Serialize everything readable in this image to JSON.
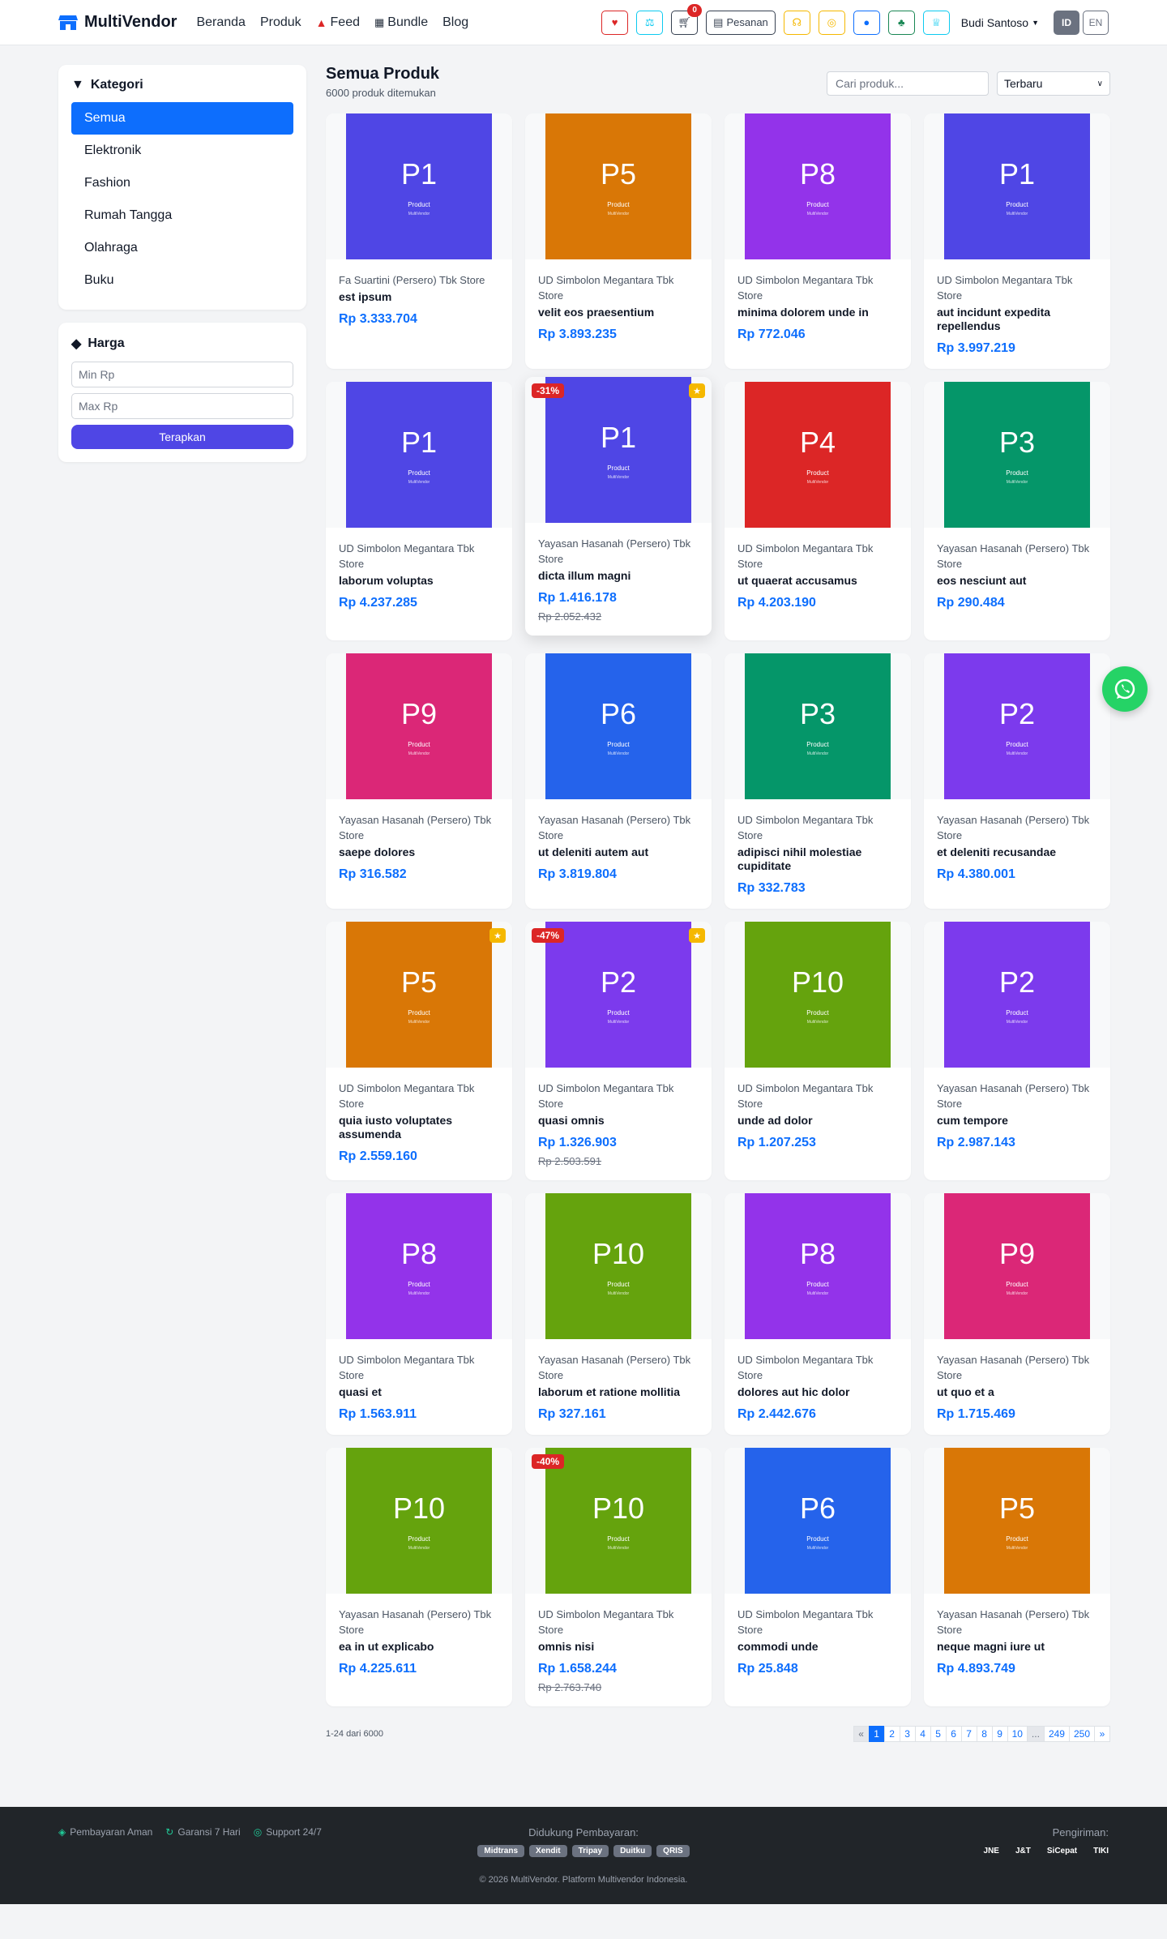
{
  "nav": {
    "brand": "MultiVendor",
    "links": [
      "Beranda",
      "Produk",
      "Feed",
      "Bundle",
      "Blog"
    ],
    "orders_label": "Pesanan",
    "cart_count": "0",
    "user": "Budi Santoso",
    "lang_id": "ID",
    "lang_en": "EN"
  },
  "sidebar": {
    "category_title": "Kategori",
    "categories": [
      "Semua",
      "Elektronik",
      "Fashion",
      "Rumah Tangga",
      "Olahraga",
      "Buku"
    ],
    "price_title": "Harga",
    "min_placeholder": "Min Rp",
    "max_placeholder": "Max Rp",
    "apply_label": "Terapkan"
  },
  "main": {
    "title": "Semua Produk",
    "count_text": "6000 produk ditemukan",
    "search_placeholder": "Cari produk...",
    "sort_value": "Terbaru"
  },
  "colors": {
    "brand": "#0d6efd",
    "apply": "#4f46e5",
    "discount": "#dc2626",
    "featured": "#f5b800"
  },
  "products": [
    {
      "code": "P1",
      "color": "#4f46e5",
      "store": "Fa Suartini (Persero) Tbk Store",
      "name": "est ipsum",
      "price": "Rp 3.333.704",
      "old": "",
      "disc": "",
      "feat": false
    },
    {
      "code": "P5",
      "color": "#d97706",
      "store": "UD Simbolon Megantara Tbk Store",
      "name": "velit eos praesentium",
      "price": "Rp 3.893.235",
      "old": "",
      "disc": "",
      "feat": false
    },
    {
      "code": "P8",
      "color": "#9333ea",
      "store": "UD Simbolon Megantara Tbk Store",
      "name": "minima dolorem unde in",
      "price": "Rp 772.046",
      "old": "",
      "disc": "",
      "feat": false
    },
    {
      "code": "P1",
      "color": "#4f46e5",
      "store": "UD Simbolon Megantara Tbk Store",
      "name": "aut incidunt expedita repellendus",
      "price": "Rp 3.997.219",
      "old": "",
      "disc": "",
      "feat": false
    },
    {
      "code": "P1",
      "color": "#4f46e5",
      "store": "UD Simbolon Megantara Tbk Store",
      "name": "laborum voluptas",
      "price": "Rp 4.237.285",
      "old": "",
      "disc": "",
      "feat": false
    },
    {
      "code": "P1",
      "color": "#4f46e5",
      "store": "Yayasan Hasanah (Persero) Tbk Store",
      "name": "dicta illum magni",
      "price": "Rp 1.416.178",
      "old": "Rp 2.052.432",
      "disc": "-31%",
      "feat": true,
      "hover": true
    },
    {
      "code": "P4",
      "color": "#dc2626",
      "store": "UD Simbolon Megantara Tbk Store",
      "name": "ut quaerat accusamus",
      "price": "Rp 4.203.190",
      "old": "",
      "disc": "",
      "feat": false
    },
    {
      "code": "P3",
      "color": "#059669",
      "store": "Yayasan Hasanah (Persero) Tbk Store",
      "name": "eos nesciunt aut",
      "price": "Rp 290.484",
      "old": "",
      "disc": "",
      "feat": false
    },
    {
      "code": "P9",
      "color": "#db2777",
      "store": "Yayasan Hasanah (Persero) Tbk Store",
      "name": "saepe dolores",
      "price": "Rp 316.582",
      "old": "",
      "disc": "",
      "feat": false
    },
    {
      "code": "P6",
      "color": "#2563eb",
      "store": "Yayasan Hasanah (Persero) Tbk Store",
      "name": "ut deleniti autem aut",
      "price": "Rp 3.819.804",
      "old": "",
      "disc": "",
      "feat": false
    },
    {
      "code": "P3",
      "color": "#059669",
      "store": "UD Simbolon Megantara Tbk Store",
      "name": "adipisci nihil molestiae cupiditate",
      "price": "Rp 332.783",
      "old": "",
      "disc": "",
      "feat": false
    },
    {
      "code": "P2",
      "color": "#7c3aed",
      "store": "Yayasan Hasanah (Persero) Tbk Store",
      "name": "et deleniti recusandae",
      "price": "Rp 4.380.001",
      "old": "",
      "disc": "",
      "feat": false
    },
    {
      "code": "P5",
      "color": "#d97706",
      "store": "UD Simbolon Megantara Tbk Store",
      "name": "quia iusto voluptates assumenda",
      "price": "Rp 2.559.160",
      "old": "",
      "disc": "",
      "feat": true
    },
    {
      "code": "P2",
      "color": "#7c3aed",
      "store": "UD Simbolon Megantara Tbk Store",
      "name": "quasi omnis",
      "price": "Rp 1.326.903",
      "old": "Rp 2.503.591",
      "disc": "-47%",
      "feat": true
    },
    {
      "code": "P10",
      "color": "#65a30d",
      "store": "UD Simbolon Megantara Tbk Store",
      "name": "unde ad dolor",
      "price": "Rp 1.207.253",
      "old": "",
      "disc": "",
      "feat": false
    },
    {
      "code": "P2",
      "color": "#7c3aed",
      "store": "Yayasan Hasanah (Persero) Tbk Store",
      "name": "cum tempore",
      "price": "Rp 2.987.143",
      "old": "",
      "disc": "",
      "feat": false
    },
    {
      "code": "P8",
      "color": "#9333ea",
      "store": "UD Simbolon Megantara Tbk Store",
      "name": "quasi et",
      "price": "Rp 1.563.911",
      "old": "",
      "disc": "",
      "feat": false
    },
    {
      "code": "P10",
      "color": "#65a30d",
      "store": "Yayasan Hasanah (Persero) Tbk Store",
      "name": "laborum et ratione mollitia",
      "price": "Rp 327.161",
      "old": "",
      "disc": "",
      "feat": false
    },
    {
      "code": "P8",
      "color": "#9333ea",
      "store": "UD Simbolon Megantara Tbk Store",
      "name": "dolores aut hic dolor",
      "price": "Rp 2.442.676",
      "old": "",
      "disc": "",
      "feat": false
    },
    {
      "code": "P9",
      "color": "#db2777",
      "store": "Yayasan Hasanah (Persero) Tbk Store",
      "name": "ut quo et a",
      "price": "Rp 1.715.469",
      "old": "",
      "disc": "",
      "feat": false
    },
    {
      "code": "P10",
      "color": "#65a30d",
      "store": "Yayasan Hasanah (Persero) Tbk Store",
      "name": "ea in ut explicabo",
      "price": "Rp 4.225.611",
      "old": "",
      "disc": "",
      "feat": false
    },
    {
      "code": "P10",
      "color": "#65a30d",
      "store": "UD Simbolon Megantara Tbk Store",
      "name": "omnis nisi",
      "price": "Rp 1.658.244",
      "old": "Rp 2.763.740",
      "disc": "-40%",
      "feat": false
    },
    {
      "code": "P6",
      "color": "#2563eb",
      "store": "UD Simbolon Megantara Tbk Store",
      "name": "commodi unde",
      "price": "Rp 25.848",
      "old": "",
      "disc": "",
      "feat": false
    },
    {
      "code": "P5",
      "color": "#d97706",
      "store": "Yayasan Hasanah (Persero) Tbk Store",
      "name": "neque magni iure ut",
      "price": "Rp 4.893.749",
      "old": "",
      "disc": "",
      "feat": false
    }
  ],
  "product_img_label": "Product",
  "product_img_sub": "MultiVendor",
  "pagination": {
    "info": "1-24 dari 6000",
    "prev": "«",
    "next": "»",
    "pages": [
      "1",
      "2",
      "3",
      "4",
      "5",
      "6",
      "7",
      "8",
      "9",
      "10",
      "...",
      "249",
      "250"
    ],
    "active": "1"
  },
  "footer": {
    "secure": "Pembayaran Aman",
    "warranty": "Garansi 7 Hari",
    "support": "Support 24/7",
    "payments_title": "Didukung Pembayaran:",
    "payments": [
      "Midtrans",
      "Xendit",
      "Tripay",
      "Duitku",
      "QRIS"
    ],
    "shipping_title": "Pengiriman:",
    "shipping": [
      "JNE",
      "J&T",
      "SiCepat",
      "TIKI"
    ],
    "copyright": "© 2026 MultiVendor. Platform Multivendor Indonesia."
  }
}
